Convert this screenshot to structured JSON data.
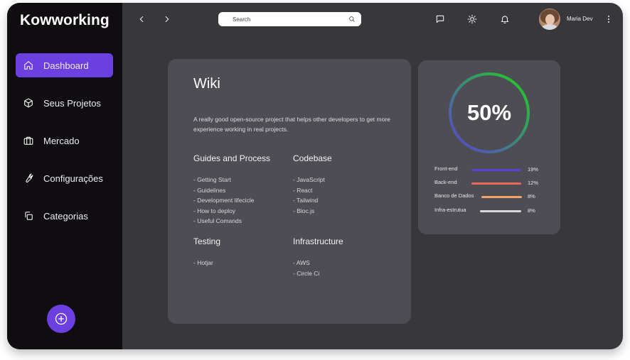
{
  "app": {
    "title": "Kowworking"
  },
  "sidebar": {
    "items": [
      {
        "label": "Dashboard",
        "icon": "home-icon",
        "active": true
      },
      {
        "label": "Seus Projetos",
        "icon": "box-icon",
        "active": false
      },
      {
        "label": "Mercado",
        "icon": "briefcase-icon",
        "active": false
      },
      {
        "label": "Configurações",
        "icon": "wrench-icon",
        "active": false
      },
      {
        "label": "Categorias",
        "icon": "copy-icon",
        "active": false
      }
    ],
    "fab_icon": "plus-circle-icon"
  },
  "topbar": {
    "search_placeholder": "Search",
    "user_name": "Maria Dev"
  },
  "wiki": {
    "title": "Wiki",
    "description": "A really good open-source project that helps other developers to get more experience working in real projects.",
    "sections": [
      {
        "title": "Guides and Process",
        "items": [
          "- Getting Start",
          "- Guidelines",
          "- Development lifecicle",
          "- How to deploy",
          "- Useful Comands"
        ]
      },
      {
        "title": "Codebase",
        "items": [
          "- JavaScript",
          "- React",
          "- Tailwind",
          "- Bloc.js"
        ]
      },
      {
        "title": "Testing",
        "items": [
          "- Hotjar"
        ]
      },
      {
        "title": "Infrastructure",
        "items": [
          "- AWS",
          "- Circle Ci"
        ]
      }
    ]
  },
  "progress": {
    "value_label": "50%",
    "value": 50,
    "colors": {
      "ring_start": "#5b3fd6",
      "ring_end": "#1fd31f",
      "track": "#4e4d53"
    },
    "stats": [
      {
        "name": "Front-end",
        "percent": "19%",
        "color": "#5b3fd6"
      },
      {
        "name": "Back-end",
        "percent": "12%",
        "color": "#e8695a"
      },
      {
        "name": "Banco de Dados",
        "percent": "8%",
        "color": "#f0a36a"
      },
      {
        "name": "Infra-estrutua",
        "percent": "8%",
        "color": "#d8d8dc"
      }
    ]
  },
  "colors": {
    "accent": "#6b3fe0",
    "sidebar_bg": "#100d11",
    "main_bg": "#38373c",
    "card_bg": "#4e4d53"
  }
}
